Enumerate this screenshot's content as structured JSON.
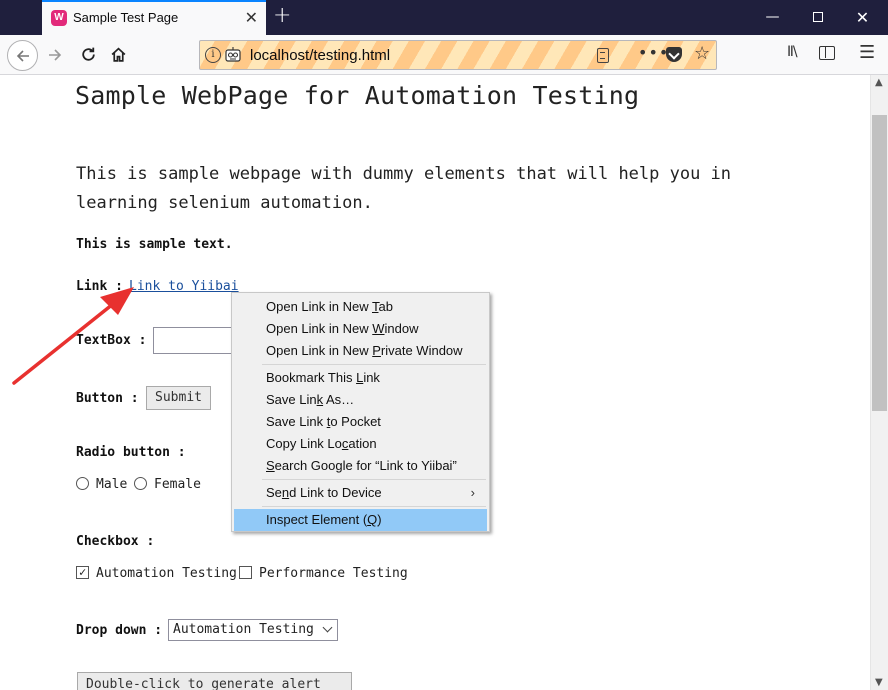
{
  "browser": {
    "tab_title": "Sample Test Page",
    "tab_favicon": "W",
    "tab_close": "✕",
    "new_tab": "+",
    "minimize": "—",
    "close": "✕",
    "url": "localhost/testing.html",
    "info": "i",
    "more": "•••",
    "library": "Ⅱ\\",
    "menu": "☰"
  },
  "page": {
    "heading": "Sample WebPage for Automation Testing",
    "intro": "This is sample webpage with dummy elements that will help you in learning selenium automation.",
    "sample_text": "This is sample text.",
    "link_label": "Link :",
    "link_text": "Link to Yiibai",
    "textbox_label": "TextBox :",
    "button_label": "Button :",
    "submit_label": "Submit",
    "radio_label": "Radio button :",
    "radio_options": [
      "Male",
      "Female"
    ],
    "checkbox_label": "Checkbox :",
    "checkbox_options": [
      {
        "label": "Automation Testing",
        "checked": true
      },
      {
        "label": "Performance Testing",
        "checked": false
      }
    ],
    "dropdown_label": "Drop down :",
    "dropdown_value": "Automation Testing",
    "dblclick_label": "Double-click to generate alert box"
  },
  "context_menu": {
    "items": [
      {
        "pre": "Open Link in New ",
        "key": "T",
        "post": "ab"
      },
      {
        "pre": "Open Link in New ",
        "key": "W",
        "post": "indow"
      },
      {
        "pre": "Open Link in New ",
        "key": "P",
        "post": "rivate Window"
      },
      {
        "pre": "Bookmark This ",
        "key": "L",
        "post": "ink"
      },
      {
        "pre": "Save Lin",
        "key": "k",
        "post": " As…"
      },
      {
        "pre": "Save Link ",
        "key": "t",
        "post": "o Pocket"
      },
      {
        "pre": "Copy Link Lo",
        "key": "c",
        "post": "ation"
      },
      {
        "pre": "",
        "key": "S",
        "post": "earch Google for “Link to Yiibai”"
      },
      {
        "pre": "Se",
        "key": "n",
        "post": "d Link to Device"
      },
      {
        "pre": "Inspect Element (",
        "key": "Q",
        "post": ")"
      }
    ],
    "submenu_arrow": "›"
  },
  "colors": {
    "titlebar": "#1f1f3d",
    "tab_accent": "#0a84ff",
    "highlight": "#91c9f7",
    "annotation_arrow": "#e8312f"
  }
}
